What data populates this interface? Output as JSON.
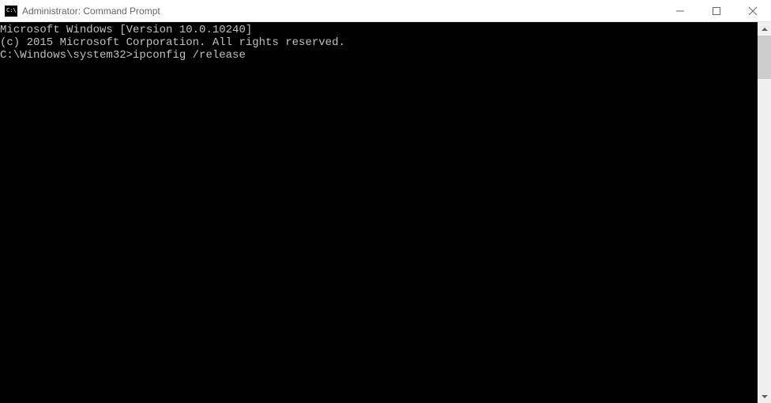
{
  "window": {
    "title": "Administrator: Command Prompt",
    "icon_badge": "C:\\."
  },
  "terminal": {
    "line1": "Microsoft Windows [Version 10.0.10240]",
    "line2": "(c) 2015 Microsoft Corporation. All rights reserved.",
    "blank": "",
    "prompt": "C:\\Windows\\system32>",
    "command": "ipconfig /release"
  }
}
